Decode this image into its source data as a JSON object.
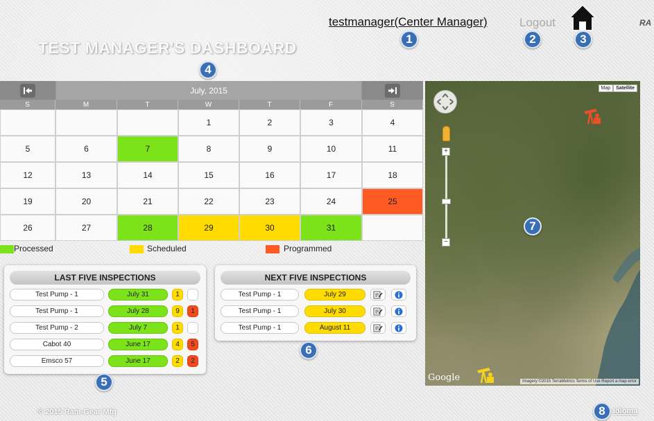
{
  "header": {
    "user_link": "testmanager(Center Manager)",
    "logout_label": "Logout",
    "brand_corner": "RA",
    "title": "TEST MANAGER'S DASHBOARD"
  },
  "markers": [
    "1",
    "2",
    "3",
    "4",
    "5",
    "6",
    "7",
    "8"
  ],
  "calendar": {
    "month_label": "July, 2015",
    "prev_icon": "arrow-left-to-bar",
    "next_icon": "arrow-right-to-bar",
    "weekdays": [
      "S",
      "M",
      "T",
      "W",
      "T",
      "F",
      "S"
    ],
    "weeks": [
      [
        {
          "d": "",
          "s": ""
        },
        {
          "d": "",
          "s": ""
        },
        {
          "d": "",
          "s": ""
        },
        {
          "d": "1",
          "s": ""
        },
        {
          "d": "2",
          "s": ""
        },
        {
          "d": "3",
          "s": ""
        },
        {
          "d": "4",
          "s": ""
        }
      ],
      [
        {
          "d": "5",
          "s": ""
        },
        {
          "d": "6",
          "s": ""
        },
        {
          "d": "7",
          "s": "processed"
        },
        {
          "d": "8",
          "s": ""
        },
        {
          "d": "9",
          "s": ""
        },
        {
          "d": "10",
          "s": ""
        },
        {
          "d": "11",
          "s": ""
        }
      ],
      [
        {
          "d": "12",
          "s": ""
        },
        {
          "d": "13",
          "s": ""
        },
        {
          "d": "14",
          "s": ""
        },
        {
          "d": "15",
          "s": ""
        },
        {
          "d": "16",
          "s": ""
        },
        {
          "d": "17",
          "s": ""
        },
        {
          "d": "18",
          "s": ""
        }
      ],
      [
        {
          "d": "19",
          "s": ""
        },
        {
          "d": "20",
          "s": ""
        },
        {
          "d": "21",
          "s": ""
        },
        {
          "d": "22",
          "s": ""
        },
        {
          "d": "23",
          "s": ""
        },
        {
          "d": "24",
          "s": ""
        },
        {
          "d": "25",
          "s": "programmed"
        }
      ],
      [
        {
          "d": "26",
          "s": ""
        },
        {
          "d": "27",
          "s": ""
        },
        {
          "d": "28",
          "s": "processed"
        },
        {
          "d": "29",
          "s": "scheduled"
        },
        {
          "d": "30",
          "s": "scheduled"
        },
        {
          "d": "31",
          "s": "processed"
        },
        {
          "d": "",
          "s": ""
        }
      ]
    ]
  },
  "legend": {
    "processed": "Processed",
    "scheduled": "Scheduled",
    "programmed": "Programmed",
    "colors": {
      "processed": "#7ce21a",
      "scheduled": "#ffdb00",
      "programmed": "#ff5a24"
    }
  },
  "last_five": {
    "title": "LAST FIVE INSPECTIONS",
    "rows": [
      {
        "name": "Test Pump - 1",
        "date": "July 31",
        "count_a": "1",
        "count_b": ""
      },
      {
        "name": "Test Pump - 1",
        "date": "July 28",
        "count_a": "9",
        "count_b": "1"
      },
      {
        "name": "Test Pump - 2",
        "date": "July 7",
        "count_a": "1",
        "count_b": ""
      },
      {
        "name": "Cabot 40",
        "date": "June 17",
        "count_a": "4",
        "count_b": "5"
      },
      {
        "name": "Emsco 57",
        "date": "June 17",
        "count_a": "2",
        "count_b": "2"
      }
    ]
  },
  "next_five": {
    "title": "NEXT FIVE INSPECTIONS",
    "rows": [
      {
        "name": "Test Pump - 1",
        "date": "July 29"
      },
      {
        "name": "Test Pump - 1",
        "date": "July 30"
      },
      {
        "name": "Test Pump - 1",
        "date": "August 11"
      }
    ]
  },
  "map": {
    "type_map": "Map",
    "type_satellite": "Satellite",
    "google": "Google",
    "attribution": "Imagery ©2015 TerraMetrics   Terms of Use   Report a map error"
  },
  "footer": {
    "copyright": "© 2015 Ram-Gear Mfg",
    "idioma": "Idioma"
  }
}
